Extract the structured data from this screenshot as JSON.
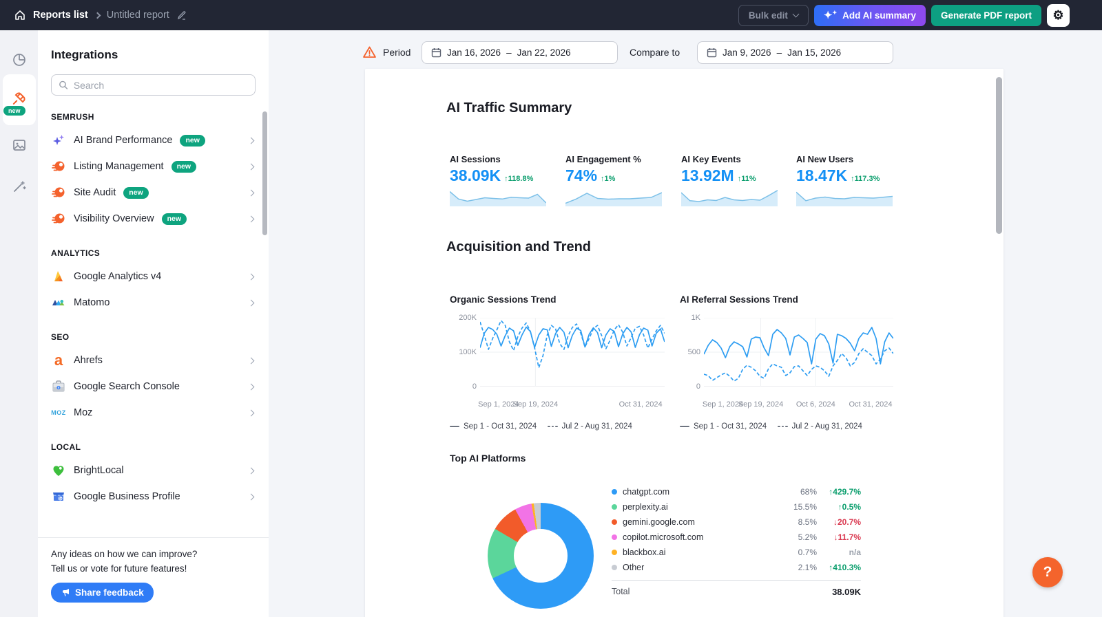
{
  "topbar": {
    "reports_list_label": "Reports list",
    "report_name": "Untitled report",
    "bulk_edit_label": "Bulk edit",
    "add_ai_summary_label": "Add AI summary",
    "generate_pdf_label": "Generate PDF report"
  },
  "icon_rail": {
    "items": [
      "widgets",
      "integrations",
      "images",
      "ai-design-tools"
    ],
    "active_item": "integrations",
    "active_badge": "new"
  },
  "sidebar": {
    "title": "Integrations",
    "search_placeholder": "Search",
    "sections": [
      {
        "label": "SEMRUSH",
        "items": [
          {
            "label": "AI Brand Performance",
            "badge": "new"
          },
          {
            "label": "Listing Management",
            "badge": "new"
          },
          {
            "label": "Site Audit",
            "badge": "new"
          },
          {
            "label": "Visibility Overview",
            "badge": "new"
          }
        ]
      },
      {
        "label": "ANALYTICS",
        "items": [
          {
            "label": "Google Analytics v4"
          },
          {
            "label": "Matomo"
          }
        ]
      },
      {
        "label": "SEO",
        "items": [
          {
            "label": "Ahrefs"
          },
          {
            "label": "Google Search Console"
          },
          {
            "label": "Moz"
          }
        ]
      },
      {
        "label": "LOCAL",
        "items": [
          {
            "label": "BrightLocal"
          },
          {
            "label": "Google Business Profile"
          }
        ]
      }
    ],
    "feedback": {
      "line1": "Any ideas on how we can improve?",
      "line2": "Tell us or vote for future features!",
      "button_label": "Share feedback"
    }
  },
  "period_bar": {
    "period_label": "Period",
    "period_start": "Jan 16, 2026",
    "period_end": "Jan 22, 2026",
    "separator": "–",
    "compare_label": "Compare to",
    "compare_start": "Jan 9, 2026",
    "compare_end": "Jan 15, 2026"
  },
  "report": {
    "ai_traffic_summary_title": "AI Traffic Summary",
    "acquisition_title": "Acquisition and Trend",
    "metrics": [
      {
        "label": "AI Sessions",
        "value": "38.09K",
        "change": "↑118.8%",
        "direction": "up"
      },
      {
        "label": "AI Engagement %",
        "value": "74%",
        "change": "↑1%",
        "direction": "up"
      },
      {
        "label": "AI Key Events",
        "value": "13.92M",
        "change": "↑11%",
        "direction": "up"
      },
      {
        "label": "AI New Users",
        "value": "18.47K",
        "change": "↑117.3%",
        "direction": "up"
      }
    ]
  },
  "help_button_label": "?",
  "colors": {
    "topbar_bg": "#222634",
    "accent_blue": "#2f7cf6",
    "metric_blue": "#1390f5",
    "green_button": "#0d9f82",
    "badge_green": "#0ea47f",
    "semrush_orange": "#f4622d",
    "up_green": "#0b9e6d",
    "down_red": "#da3a51",
    "chart_line_blue": "#2d9df2",
    "help_orange": "#f4642c"
  },
  "chart_data": {
    "organic": {
      "type": "line",
      "title": "Organic Sessions Trend",
      "ylabel_unit": "K sessions",
      "ylim": [
        0,
        200
      ],
      "yticks": [
        "200K",
        "100K",
        "0"
      ],
      "xticks": [
        "Sep 1, 2024",
        "Sep 19, 2024",
        "Oct 31, 2024"
      ],
      "series": [
        {
          "name": "Sep 1 - Oct 31, 2024",
          "style": "solid",
          "values": [
            113,
            155,
            172,
            166,
            152,
            118,
            148,
            170,
            162,
            120,
            150,
            173,
            160,
            114,
            150,
            168,
            165,
            117,
            154,
            172,
            158,
            113,
            149,
            170,
            163,
            115,
            152,
            171,
            157,
            113,
            150,
            168,
            160,
            116,
            153,
            172,
            159,
            114,
            151,
            170,
            164,
            118,
            155,
            168,
            130
          ]
        },
        {
          "name": "Jul 2 - Aug 31, 2024",
          "style": "dashed",
          "values": [
            188,
            150,
            108,
            140,
            165,
            192,
            178,
            130,
            105,
            145,
            170,
            185,
            160,
            112,
            55,
            90,
            150,
            178,
            168,
            125,
            108,
            148,
            172,
            182,
            155,
            115,
            140,
            168,
            178,
            148,
            110,
            135,
            165,
            180,
            158,
            118,
            142,
            170,
            175,
            150,
            112,
            138,
            162,
            178,
            155
          ]
        }
      ]
    },
    "referral": {
      "type": "line",
      "title": "AI Referral Sessions Trend",
      "ylabel_unit": "sessions",
      "ylim": [
        0,
        1000
      ],
      "yticks": [
        "1K",
        "500",
        "0"
      ],
      "xticks": [
        "Sep 1, 2024",
        "Sep 19, 2024",
        "Oct 6, 2024",
        "Oct 31, 2024"
      ],
      "series": [
        {
          "name": "Sep 1 - Oct 31, 2024",
          "style": "solid",
          "values": [
            470,
            600,
            680,
            640,
            560,
            420,
            580,
            650,
            620,
            580,
            430,
            690,
            720,
            710,
            560,
            450,
            760,
            830,
            780,
            700,
            460,
            720,
            750,
            700,
            640,
            330,
            690,
            770,
            740,
            620,
            340,
            760,
            740,
            700,
            630,
            520,
            700,
            780,
            760,
            860,
            700,
            330,
            650,
            780,
            700
          ]
        },
        {
          "name": "Jul 2 - Aug 31, 2024",
          "style": "dashed",
          "values": [
            180,
            160,
            90,
            130,
            170,
            200,
            150,
            80,
            120,
            250,
            310,
            280,
            230,
            150,
            120,
            260,
            330,
            300,
            280,
            160,
            200,
            290,
            300,
            230,
            160,
            250,
            300,
            280,
            230,
            150,
            300,
            380,
            480,
            420,
            300,
            350,
            480,
            550,
            500,
            450,
            330,
            400,
            520,
            560,
            480
          ]
        }
      ]
    },
    "sparklines": {
      "type": "area",
      "note": "normalized 0-100 shapes under each summary metric",
      "series": [
        {
          "metric": "AI Sessions",
          "values": [
            78,
            35,
            22,
            32,
            42,
            38,
            35,
            45,
            42,
            40,
            62,
            12
          ]
        },
        {
          "metric": "AI Engagement %",
          "values": [
            10,
            35,
            68,
            38,
            34,
            36,
            36,
            40,
            44,
            72
          ]
        },
        {
          "metric": "AI Key Events",
          "values": [
            72,
            25,
            20,
            30,
            26,
            44,
            30,
            26,
            32,
            28,
            55,
            85
          ]
        },
        {
          "metric": "AI New Users",
          "values": [
            75,
            25,
            40,
            46,
            38,
            36,
            44,
            42,
            40,
            45,
            50
          ]
        }
      ]
    },
    "top_ai_platforms": {
      "type": "donut",
      "title": "Top AI Platforms",
      "total_label": "Total",
      "total_value": "38.09K",
      "slices": [
        {
          "label": "chatgpt.com",
          "value": 68,
          "pct": "68%",
          "change": "↑429.7%",
          "direction": "up",
          "color": "#2E9BF6"
        },
        {
          "label": "perplexity.ai",
          "value": 15.5,
          "pct": "15.5%",
          "change": "↑0.5%",
          "direction": "up",
          "color": "#5BD69B"
        },
        {
          "label": "gemini.google.com",
          "value": 8.5,
          "pct": "8.5%",
          "change": "↓20.7%",
          "direction": "down",
          "color": "#F25B2A"
        },
        {
          "label": "copilot.microsoft.com",
          "value": 5.2,
          "pct": "5.2%",
          "change": "↓11.7%",
          "direction": "down",
          "color": "#F273E6"
        },
        {
          "label": "blackbox.ai",
          "value": 0.7,
          "pct": "0.7%",
          "change": "n/a",
          "direction": "na",
          "color": "#FFB224"
        },
        {
          "label": "Other",
          "value": 2.1,
          "pct": "2.1%",
          "change": "↑410.3%",
          "direction": "up",
          "color": "#C8CCD3"
        }
      ]
    }
  }
}
